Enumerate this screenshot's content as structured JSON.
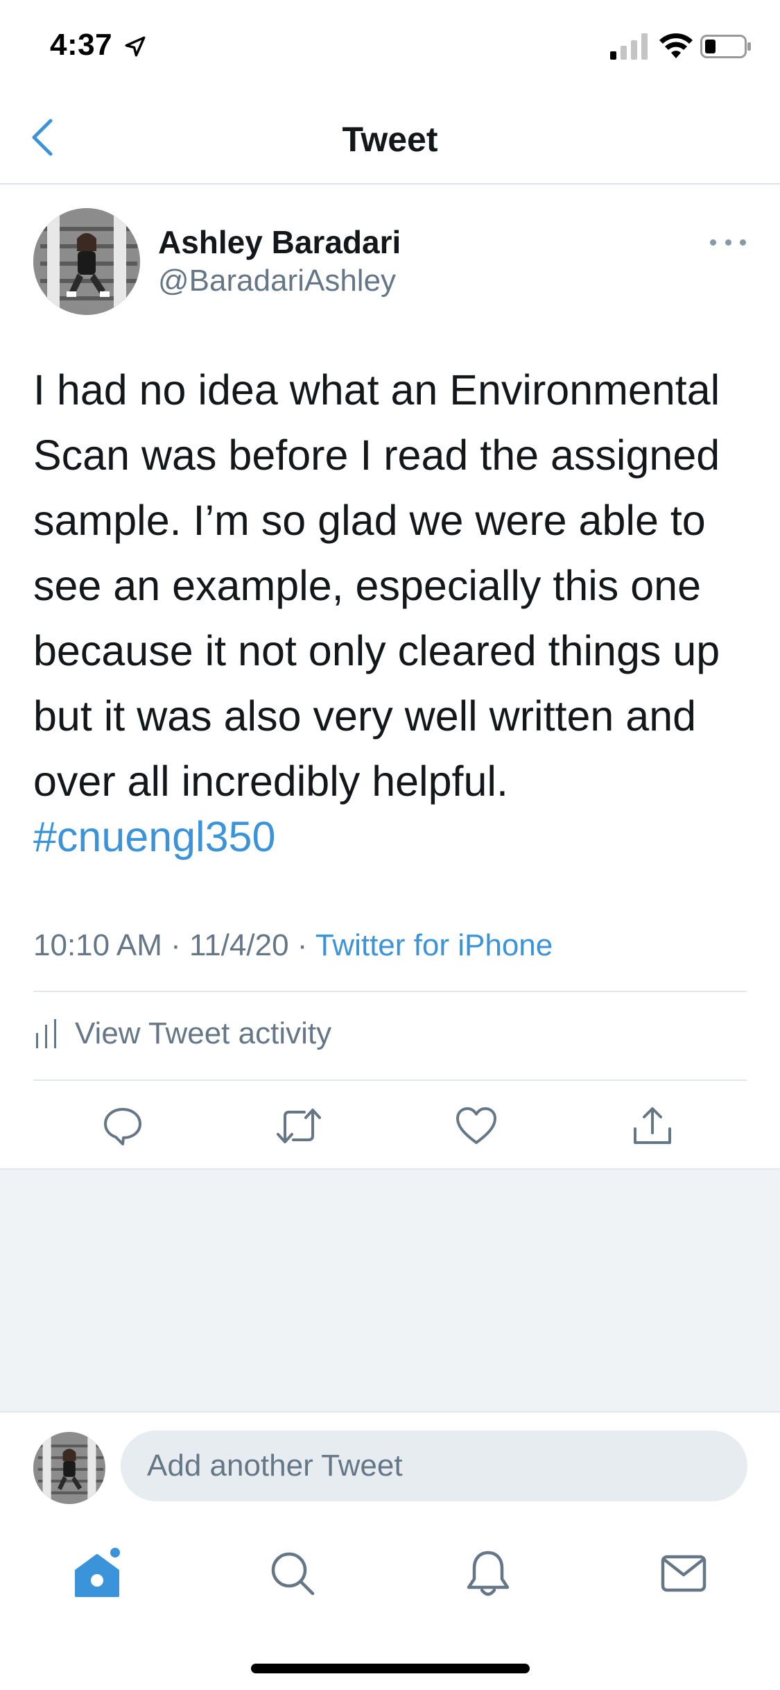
{
  "status_bar": {
    "time": "4:37"
  },
  "header": {
    "title": "Tweet"
  },
  "tweet": {
    "author_name": "Ashley Baradari",
    "author_handle": "@BaradariAshley",
    "text": "I had no idea what an Environmental\nScan was before I read the assigned\nsample. I’m so glad we were able to\nsee an example, especially this one\nbecause it not only cleared things up\nbut it was also very well written and\nover all incredibly helpful.",
    "hashtag": "#cnuengl350",
    "timestamp": "10:10 AM · 11/4/20 · ",
    "source": "Twitter for iPhone",
    "activity_label": "View Tweet activity"
  },
  "reply": {
    "placeholder": "Add another Tweet"
  },
  "tab_bar": {
    "items": [
      "home-icon",
      "search-icon",
      "notifications-icon",
      "messages-icon"
    ]
  },
  "colors": {
    "accent": "#3b94d9",
    "secondary_text": "#657786",
    "divider": "#e1e8ed",
    "background_gray": "#f0f3f6"
  }
}
